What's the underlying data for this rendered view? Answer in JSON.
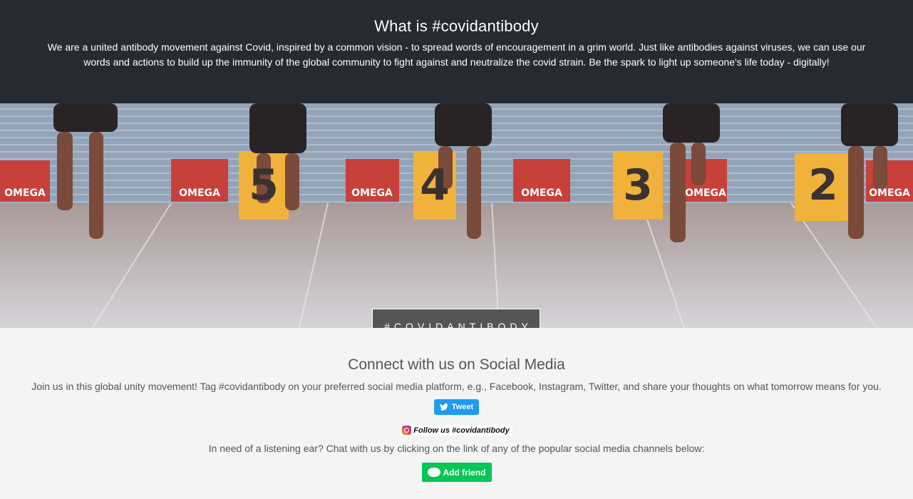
{
  "intro": {
    "title": "What is #covidantibody",
    "text": "We are a united antibody movement against Covid, inspired by a common vision - to spread words of encouragement in a grim world. Just like antibodies against viruses, we can use our words and actions to build up the immunity of the global community to fight against and neutralize the covid strain. Be the spark to light up someone's life today - digitally!"
  },
  "hero": {
    "tag": "#COVIDANTIBODY",
    "lane_numbers": [
      "5",
      "4",
      "3",
      "2"
    ],
    "sponsor_word": "OMEGA"
  },
  "social": {
    "title": "Connect with us on Social Media",
    "text": "Join us in this global unity movement! Tag #covidantibody on your preferred social media platform, e.g., Facebook, Instagram, Twitter, and share your thoughts on what tomorrow means for you.",
    "tweet_label": "Tweet",
    "instagram_label": "Follow us #covidantibody",
    "chat_text": "In need of a listening ear? Chat with us by clicking on the link of any of the popular social media channels below:",
    "line_label": "Add friend"
  },
  "colors": {
    "header_bg": "#252a33",
    "twitter_blue": "#1d9bf0",
    "line_green": "#06c755",
    "block_red": "#c8403a",
    "block_yellow": "#f0b23a"
  },
  "icons": [
    "twitter-bird-icon",
    "instagram-icon",
    "line-icon"
  ]
}
